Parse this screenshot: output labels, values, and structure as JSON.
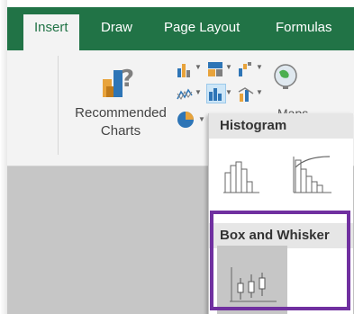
{
  "tabs": [
    {
      "label": "Insert",
      "active": true
    },
    {
      "label": "Draw",
      "active": false
    },
    {
      "label": "Page Layout",
      "active": false
    },
    {
      "label": "Formulas",
      "active": false
    }
  ],
  "ribbon": {
    "recommended_charts_line1": "Recommended",
    "recommended_charts_line2": "Charts",
    "maps_label": "Maps"
  },
  "dropdown": {
    "section1_title": "Histogram",
    "section1_items": [
      "histogram-chart-icon",
      "pareto-chart-icon"
    ],
    "section2_title": "Box and Whisker",
    "section2_items": [
      "box-whisker-chart-icon"
    ]
  },
  "colors": {
    "tab_bar": "#217346",
    "ribbon_bg": "#f3f3f3",
    "highlight": "#7030a0",
    "bar_orange": "#e8a33b",
    "bar_blue": "#2e75b6",
    "bar_gray": "#7f7f7f"
  }
}
